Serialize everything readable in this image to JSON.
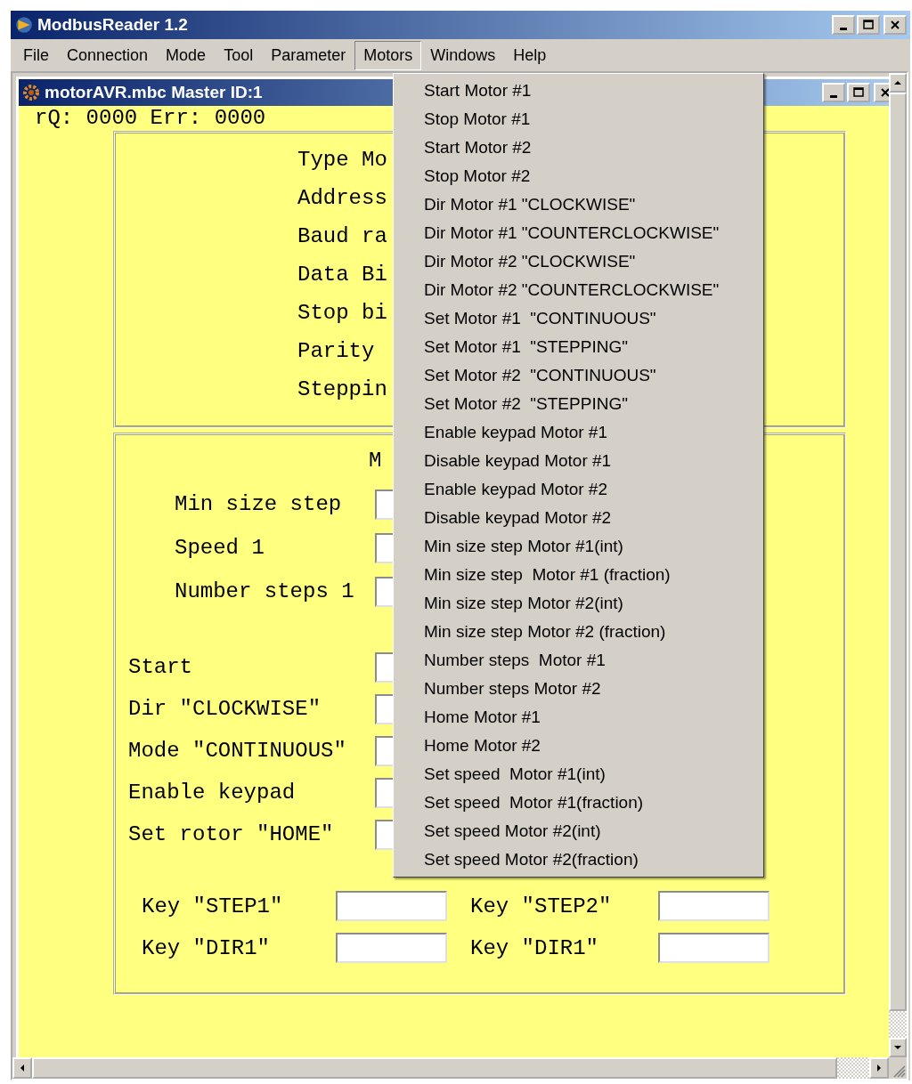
{
  "app": {
    "title": "ModbusReader 1.2"
  },
  "menu_bar": [
    {
      "label": "File",
      "selected": false
    },
    {
      "label": "Connection",
      "selected": false
    },
    {
      "label": "Mode",
      "selected": false
    },
    {
      "label": "Tool",
      "selected": false
    },
    {
      "label": "Parameter",
      "selected": false
    },
    {
      "label": "Motors",
      "selected": true
    },
    {
      "label": "Windows",
      "selected": false
    },
    {
      "label": "Help",
      "selected": false
    }
  ],
  "open_menu": {
    "items": [
      "Start Motor #1",
      "Stop Motor #1",
      "Start Motor #2",
      "Stop Motor #2",
      "Dir Motor #1 \"CLOCKWISE\"",
      "Dir Motor #1 \"COUNTERCLOCKWISE\"",
      "Dir Motor #2 \"CLOCKWISE\"",
      "Dir Motor #2 \"COUNTERCLOCKWISE\"",
      "Set Motor #1  \"CONTINUOUS\"",
      "Set Motor #1  \"STEPPING\"",
      "Set Motor #2  \"CONTINUOUS\"",
      "Set Motor #2  \"STEPPING\"",
      "Enable keypad Motor #1",
      "Disable keypad Motor #1",
      "Enable keypad Motor #2",
      "Disable keypad Motor #2",
      "Min size step Motor #1(int)",
      "Min size step  Motor #1 (fraction)",
      "Min size step Motor #2(int)",
      "Min size step Motor #2 (fraction)",
      "Number steps  Motor #1",
      "Number steps Motor #2",
      "Home Motor #1",
      "Home Motor #2",
      "Set speed  Motor #1(int)",
      "Set speed  Motor #1(fraction)",
      "Set speed Motor #2(int)",
      "Set speed Motor #2(fraction)"
    ]
  },
  "child_window": {
    "title": "motorAVR.mbc Master ID:1",
    "status": "rQ: 0000 Err: 0000",
    "settings_panel": {
      "labels": [
        "Type Mo",
        "Address",
        "Baud ra",
        "Data Bi",
        "Stop bi",
        "Parity",
        "Steppin"
      ]
    },
    "motor_panel": {
      "heading": "M",
      "parameters": [
        {
          "label": "Min size step"
        },
        {
          "label": "Speed 1"
        },
        {
          "label": "Number steps 1"
        }
      ],
      "controls": [
        {
          "label": "Start"
        },
        {
          "label": "Dir \"CLOCKWISE\""
        },
        {
          "label": "Mode \"CONTINUOUS\""
        },
        {
          "label": "Enable keypad"
        },
        {
          "label": "Set rotor \"HOME\""
        }
      ],
      "keys": [
        {
          "label": "Key \"STEP1\""
        },
        {
          "label": "Key \"STEP2\""
        },
        {
          "label": "Key \"DIR1\""
        },
        {
          "label": "Key \"DIR1\""
        }
      ]
    }
  }
}
